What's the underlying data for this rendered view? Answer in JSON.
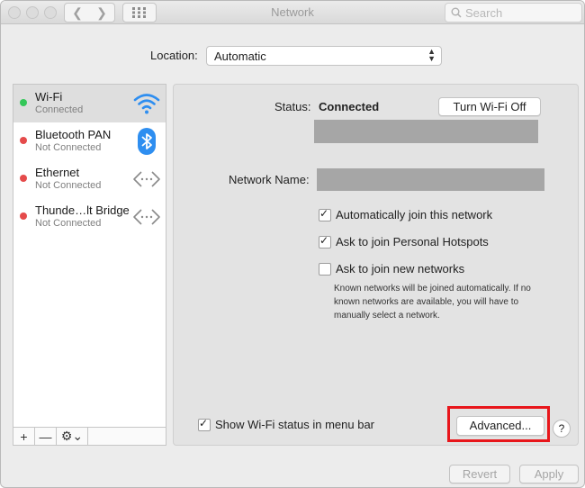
{
  "window": {
    "title": "Network"
  },
  "search": {
    "placeholder": "Search"
  },
  "location": {
    "label": "Location:",
    "value": "Automatic"
  },
  "services": [
    {
      "name": "Wi-Fi",
      "status": "Connected",
      "dot_color": "#34c759",
      "icon": "wifi-icon"
    },
    {
      "name": "Bluetooth PAN",
      "status": "Not Connected",
      "dot_color": "#e54b4b",
      "icon": "bluetooth-icon"
    },
    {
      "name": "Ethernet",
      "status": "Not Connected",
      "dot_color": "#e54b4b",
      "icon": "ethernet-icon"
    },
    {
      "name": "Thunde…lt Bridge",
      "status": "Not Connected",
      "dot_color": "#e54b4b",
      "icon": "bridge-icon"
    }
  ],
  "sidebar_toolbar": {
    "add": "+",
    "remove": "—",
    "gear": "⚙⌄"
  },
  "detail": {
    "status_label": "Status:",
    "status_value": "Connected",
    "turn_off_button": "Turn Wi-Fi Off",
    "network_name_label": "Network Name:",
    "options": [
      {
        "label": "Automatically join this network",
        "checked": true
      },
      {
        "label": "Ask to join Personal Hotspots",
        "checked": true
      },
      {
        "label": "Ask to join new networks",
        "checked": false
      }
    ],
    "note": "Known networks will be joined automatically. If no known networks are available, you will have to manually select a network.",
    "show_status_label": "Show Wi-Fi status in menu bar",
    "show_status_checked": true,
    "advanced_button": "Advanced...",
    "help_button": "?"
  },
  "footer": {
    "revert": "Revert",
    "apply": "Apply"
  },
  "colors": {
    "highlight": "#e8161b",
    "wifi_blue": "#2e8ef0",
    "connected": "#34c759",
    "disconnected": "#e54b4b"
  }
}
